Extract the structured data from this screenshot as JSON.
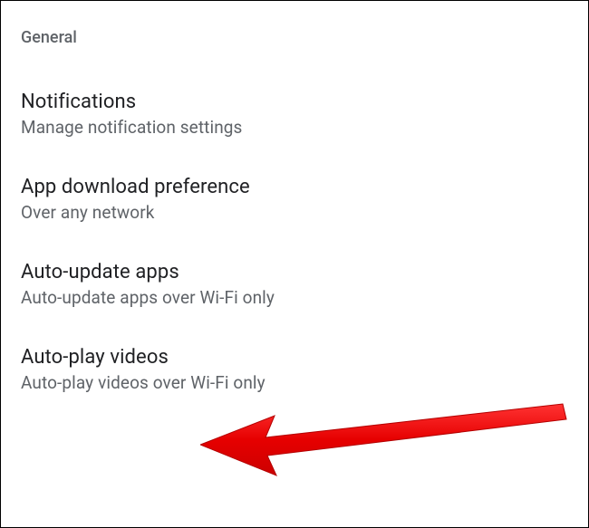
{
  "section": {
    "header": "General",
    "items": [
      {
        "title": "Notifications",
        "subtitle": "Manage notification settings"
      },
      {
        "title": "App download preference",
        "subtitle": "Over any network"
      },
      {
        "title": "Auto-update apps",
        "subtitle": "Auto-update apps over Wi-Fi only"
      },
      {
        "title": "Auto-play videos",
        "subtitle": "Auto-play videos over Wi-Fi only"
      }
    ]
  },
  "annotation": {
    "arrow_target": "Auto-play videos",
    "arrow_color": "#e60000"
  }
}
